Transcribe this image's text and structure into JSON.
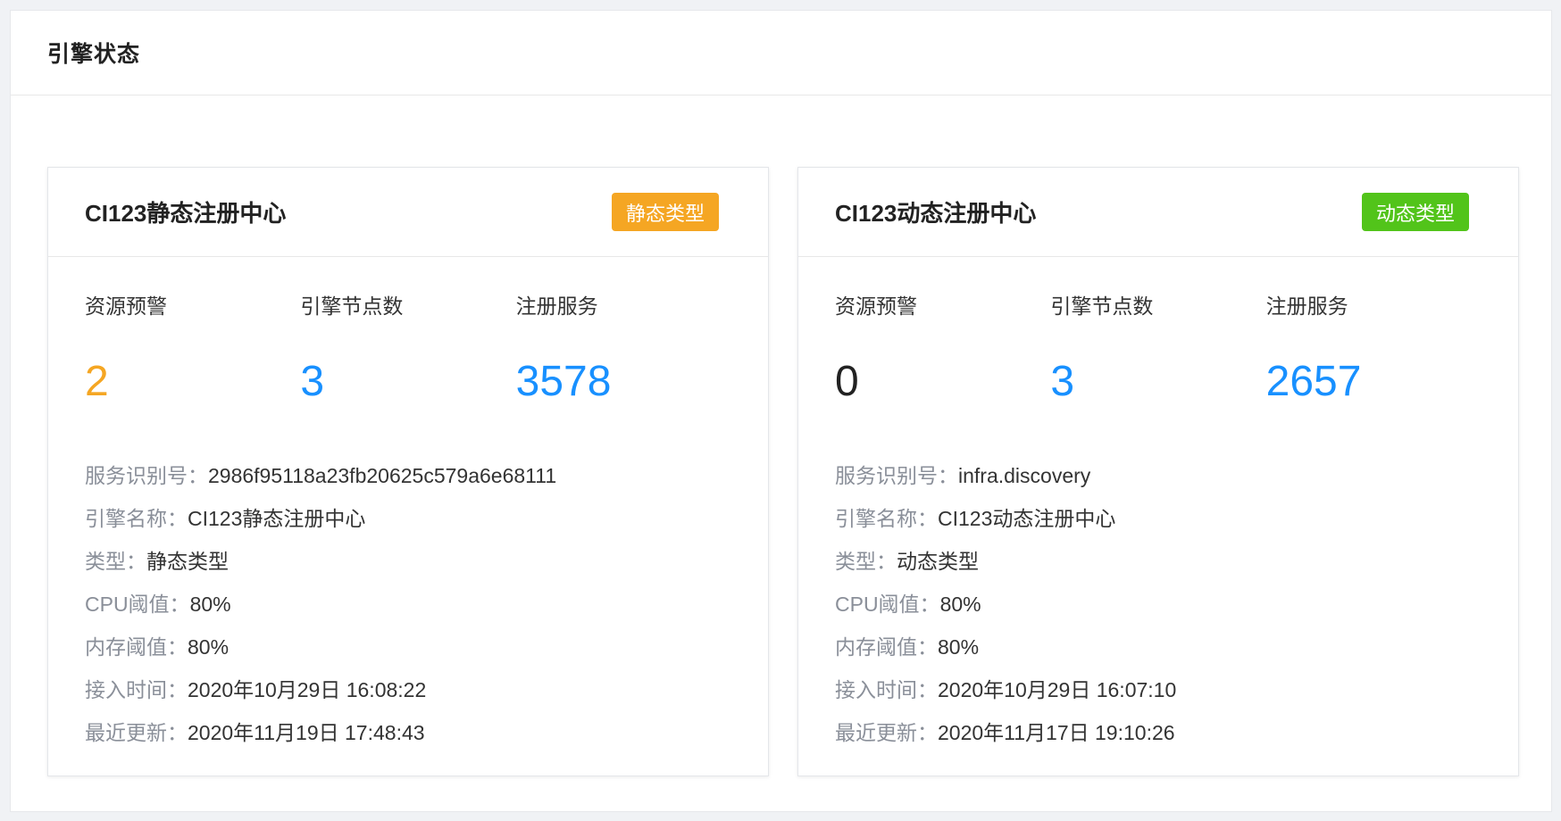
{
  "page": {
    "title": "引擎状态"
  },
  "colors": {
    "warning": "#f5a623",
    "primary": "#1890ff",
    "success": "#52c41a",
    "neutral": "#222222"
  },
  "cards": [
    {
      "title": "CI123静态注册中心",
      "badge": "静态类型",
      "badge_color": "#f5a623",
      "stats": [
        {
          "label": "资源预警",
          "value": "2",
          "color": "#f5a623"
        },
        {
          "label": "引擎节点数",
          "value": "3",
          "color": "#1890ff"
        },
        {
          "label": "注册服务",
          "value": "3578",
          "color": "#1890ff"
        }
      ],
      "info": [
        {
          "key": "服务识别号：",
          "value": "2986f95118a23fb20625c579a6e68111"
        },
        {
          "key": "引擎名称：",
          "value": "CI123静态注册中心"
        },
        {
          "key": "类型：",
          "value": "静态类型"
        },
        {
          "key": "CPU阈值：",
          "value": "80%"
        },
        {
          "key": "内存阈值：",
          "value": "80%"
        },
        {
          "key": "接入时间：",
          "value": "2020年10月29日 16:08:22"
        },
        {
          "key": "最近更新：",
          "value": "2020年11月19日 17:48:43"
        }
      ]
    },
    {
      "title": "CI123动态注册中心",
      "badge": "动态类型",
      "badge_color": "#52c41a",
      "stats": [
        {
          "label": "资源预警",
          "value": "0",
          "color": "#222222"
        },
        {
          "label": "引擎节点数",
          "value": "3",
          "color": "#1890ff"
        },
        {
          "label": "注册服务",
          "value": "2657",
          "color": "#1890ff"
        }
      ],
      "info": [
        {
          "key": "服务识别号：",
          "value": "infra.discovery"
        },
        {
          "key": "引擎名称：",
          "value": "CI123动态注册中心"
        },
        {
          "key": "类型：",
          "value": "动态类型"
        },
        {
          "key": "CPU阈值：",
          "value": "80%"
        },
        {
          "key": "内存阈值：",
          "value": "80%"
        },
        {
          "key": "接入时间：",
          "value": "2020年10月29日 16:07:10"
        },
        {
          "key": "最近更新：",
          "value": "2020年11月17日 19:10:26"
        }
      ]
    }
  ]
}
